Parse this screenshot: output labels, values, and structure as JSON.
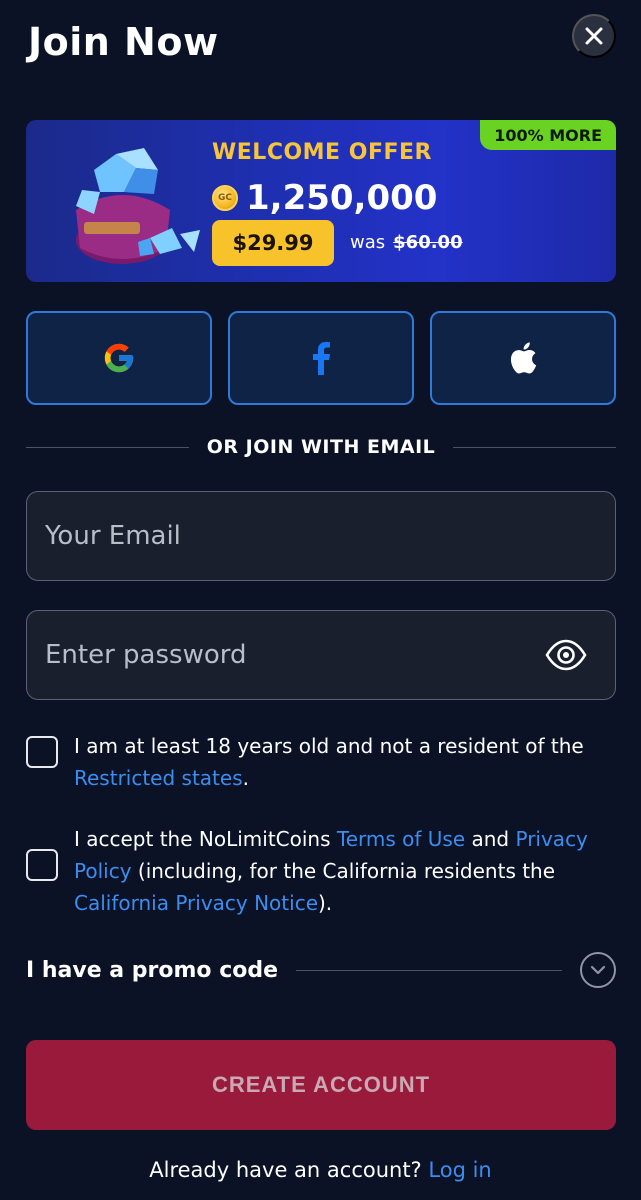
{
  "header": {
    "title": "Join Now"
  },
  "offer": {
    "badge": "100% MORE",
    "title": "WELCOME OFFER",
    "coin_label": "GC",
    "amount": "1,250,000",
    "price": "$29.99",
    "was_label": "was",
    "old_price": "$60.00"
  },
  "social": {
    "google_icon": "google-icon",
    "facebook_icon": "facebook-icon",
    "apple_icon": "apple-icon"
  },
  "divider": {
    "text": "OR JOIN WITH EMAIL"
  },
  "email": {
    "placeholder": "Your Email",
    "value": ""
  },
  "password": {
    "placeholder": "Enter password",
    "value": ""
  },
  "checkbox_age": {
    "text_before": "I am at least 18 years old and not a resident of the ",
    "link": "Restricted states",
    "text_after": "."
  },
  "checkbox_terms": {
    "text1": "I accept the NoLimitCoins ",
    "link_terms": "Terms of Use",
    "text2": " and ",
    "link_privacy": "Privacy Policy",
    "text3": " (including, for the California residents the ",
    "link_ca": "California Privacy Notice",
    "text4": ")."
  },
  "promo": {
    "label": "I have a promo code"
  },
  "create_button": {
    "label": "CREATE ACCOUNT"
  },
  "login": {
    "prompt": "Already have an account?",
    "link": "Log in"
  },
  "colors": {
    "background": "#0b1226",
    "accent_link": "#3b8df0",
    "offer_gold": "#f8c43a",
    "cta": "#9a1a3c",
    "badge_green": "#6ad322"
  }
}
